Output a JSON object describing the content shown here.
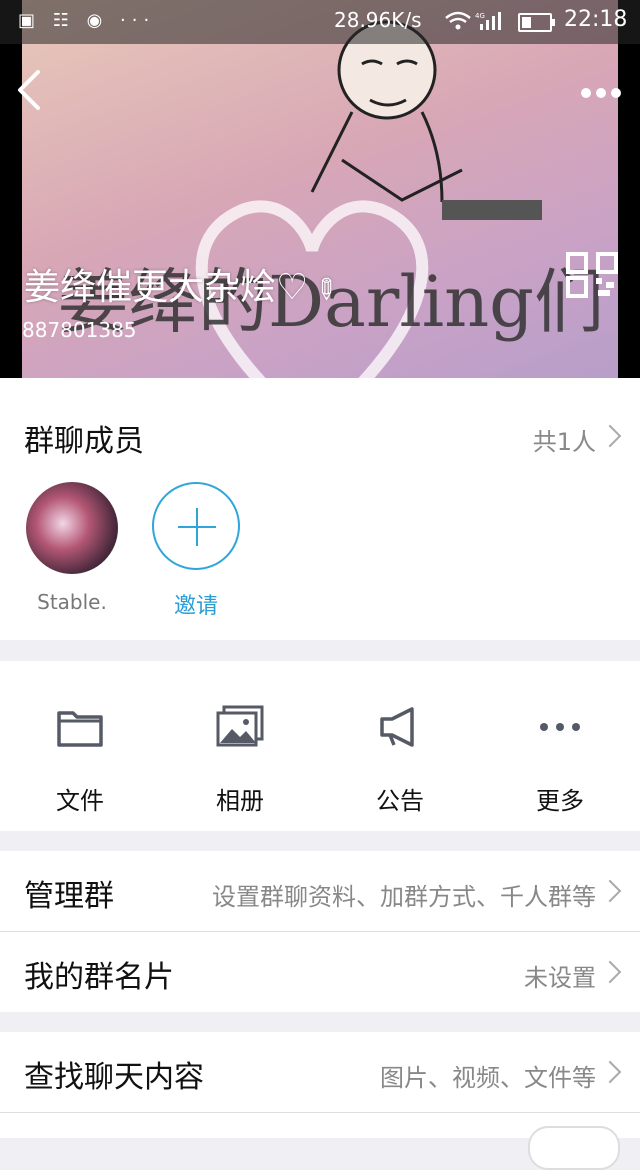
{
  "status_bar": {
    "left_icons": "▣ ☷ ◉ ···",
    "speed": "28.96K/s",
    "network": "4G",
    "time": "22:18"
  },
  "header": {
    "group_name": "姜绛催更大杂烩♡",
    "group_id": "887801385",
    "background_text": "姜绛的Darling们",
    "back_icon": "chevron-left-icon",
    "more_icon": "more-dots-icon",
    "qr_icon": "qr-code-icon",
    "edit_icon": "pencil-icon"
  },
  "members": {
    "title": "群聊成员",
    "count": "共1人",
    "list": [
      {
        "name": "Stable."
      }
    ],
    "invite_label": "邀请"
  },
  "tools": [
    {
      "label": "文件",
      "icon": "folder-icon"
    },
    {
      "label": "相册",
      "icon": "album-icon"
    },
    {
      "label": "公告",
      "icon": "megaphone-icon"
    },
    {
      "label": "更多",
      "icon": "more-dots-icon"
    }
  ],
  "rows": {
    "manage": {
      "label": "管理群",
      "value": "设置群聊资料、加群方式、千人群等"
    },
    "card": {
      "label": "我的群名片",
      "value": "未设置"
    },
    "search": {
      "label": "查找聊天内容",
      "value": "图片、视频、文件等"
    }
  },
  "colors": {
    "accent": "#2a9dd3",
    "page_bg": "#efeff4",
    "secondary_text": "#888888"
  }
}
